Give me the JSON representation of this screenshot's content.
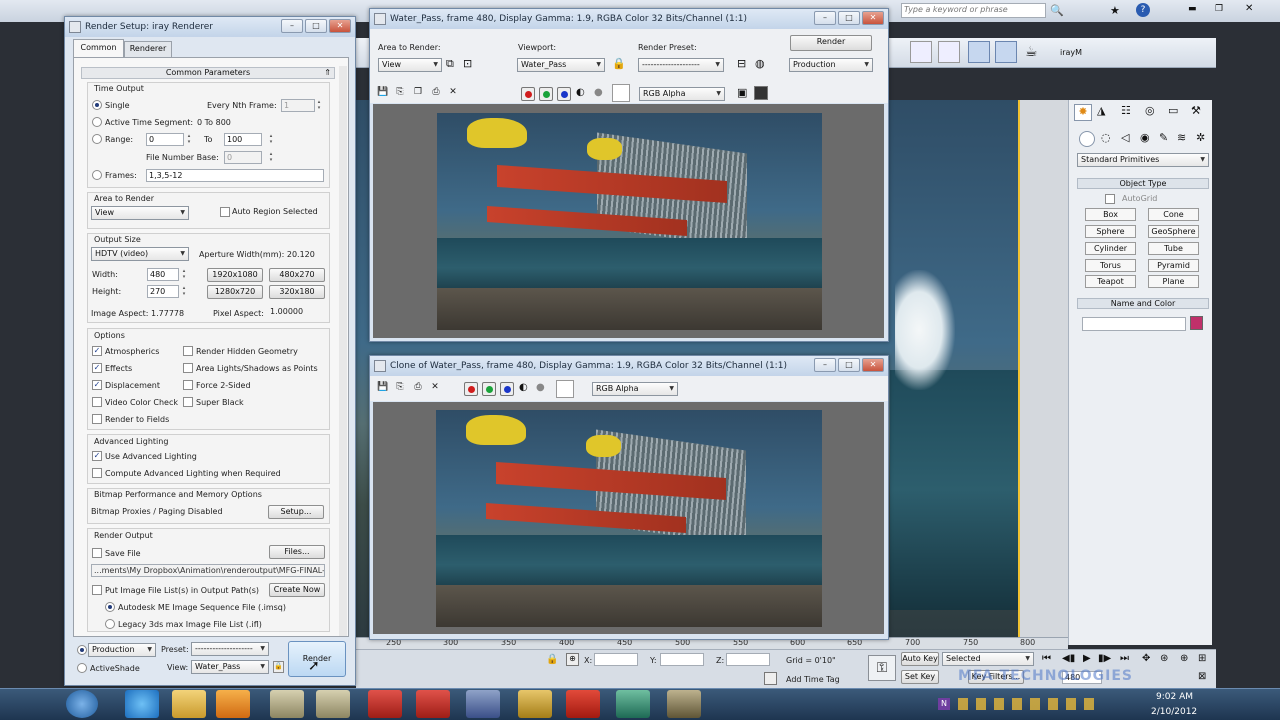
{
  "search": {
    "placeholder": "Type a keyword or phrase"
  },
  "toolbar_right": {
    "material_label": "irayM"
  },
  "render_setup": {
    "title": "Render Setup: iray Renderer",
    "tabs": [
      "Common",
      "Renderer"
    ],
    "rollout_title": "Common Parameters",
    "time_output": {
      "heading": "Time Output",
      "single": "Single",
      "every_nth_label": "Every Nth Frame:",
      "every_nth_value": "1",
      "active_segment_label": "Active Time Segment:",
      "active_segment_value": "0 To 800",
      "range_label": "Range:",
      "range_from": "0",
      "range_to_label": "To",
      "range_to": "100",
      "file_number_base_label": "File Number Base:",
      "file_number_base_value": "0",
      "frames_label": "Frames:",
      "frames_value": "1,3,5-12"
    },
    "area_to_render": {
      "heading": "Area to Render",
      "value": "View",
      "auto_region": "Auto Region Selected"
    },
    "output_size": {
      "heading": "Output Size",
      "preset": "HDTV (video)",
      "aperture": "Aperture Width(mm): 20.120",
      "width_label": "Width:",
      "width_value": "480",
      "height_label": "Height:",
      "height_value": "270",
      "presets": [
        "1920x1080",
        "480x270",
        "1280x720",
        "320x180"
      ],
      "image_aspect": "Image Aspect: 1.77778",
      "pixel_aspect_label": "Pixel Aspect:",
      "pixel_aspect_value": "1.00000"
    },
    "options": {
      "heading": "Options",
      "items_left": [
        "Atmospherics",
        "Effects",
        "Displacement",
        "Video Color Check",
        "Render to Fields"
      ],
      "items_right": [
        "Render Hidden Geometry",
        "Area Lights/Shadows as Points",
        "Force 2-Sided",
        "Super Black"
      ]
    },
    "advanced_lighting": {
      "heading": "Advanced Lighting",
      "use": "Use Advanced Lighting",
      "compute": "Compute Advanced Lighting when Required"
    },
    "bitmap": {
      "heading": "Bitmap Performance and Memory Options",
      "status": "Bitmap Proxies / Paging Disabled",
      "setup": "Setup..."
    },
    "render_output": {
      "heading": "Render Output",
      "save_file": "Save File",
      "files_button": "Files...",
      "path": "...ments\\My Dropbox\\Animation\\renderoutput\\MFG-FINAL-.tif",
      "put_image": "Put Image File List(s) in Output Path(s)",
      "create_now": "Create Now",
      "autodesk_seq": "Autodesk ME Image Sequence File (.imsq)",
      "legacy": "Legacy 3ds max Image File List (.ifl)"
    },
    "bottom": {
      "production": "Production",
      "activeshade": "ActiveShade",
      "preset_label": "Preset:",
      "preset_value": "--------------------",
      "view_label": "View:",
      "view_value": "Water_Pass",
      "render_button": "Render"
    }
  },
  "frame_window": {
    "title": "Water_Pass, frame 480, Display Gamma: 1.9, RGBA Color 32 Bits/Channel (1:1)",
    "area_label": "Area to Render:",
    "area_value": "View",
    "viewport_label": "Viewport:",
    "viewport_value": "Water_Pass",
    "preset_label": "Render Preset:",
    "preset_value": "--------------------",
    "render_button": "Render",
    "production_value": "Production",
    "channel": "RGB Alpha"
  },
  "clone_window": {
    "title": "Clone of Water_Pass, frame 480, Display Gamma: 1.9, RGBA Color 32 Bits/Channel (1:1)",
    "channel": "RGB Alpha"
  },
  "command_panel": {
    "category": "Standard Primitives",
    "object_type_heading": "Object Type",
    "autogrid": "AutoGrid",
    "buttons": [
      "Box",
      "Cone",
      "Sphere",
      "GeoSphere",
      "Cylinder",
      "Tube",
      "Torus",
      "Pyramid",
      "Teapot",
      "Plane"
    ],
    "name_color_heading": "Name and Color",
    "color": "#c0306a"
  },
  "timeline": {
    "ticks": [
      "250",
      "300",
      "350",
      "400",
      "450",
      "500",
      "550",
      "600",
      "650",
      "700",
      "750",
      "800"
    ]
  },
  "status_bar": {
    "x_label": "X:",
    "y_label": "Y:",
    "z_label": "Z:",
    "grid": "Grid = 0'10\"",
    "add_time_tag": "Add Time Tag",
    "auto_key": "Auto Key",
    "selected": "Selected",
    "set_key": "Set Key",
    "key_filters": "Key Filters...",
    "frame": "480",
    "watermark": "MFA TECHNOLOGIES"
  },
  "taskbar": {
    "time": "9:02 AM",
    "date": "2/10/2012",
    "app_labels": [
      "V",
      "S",
      "N"
    ]
  }
}
